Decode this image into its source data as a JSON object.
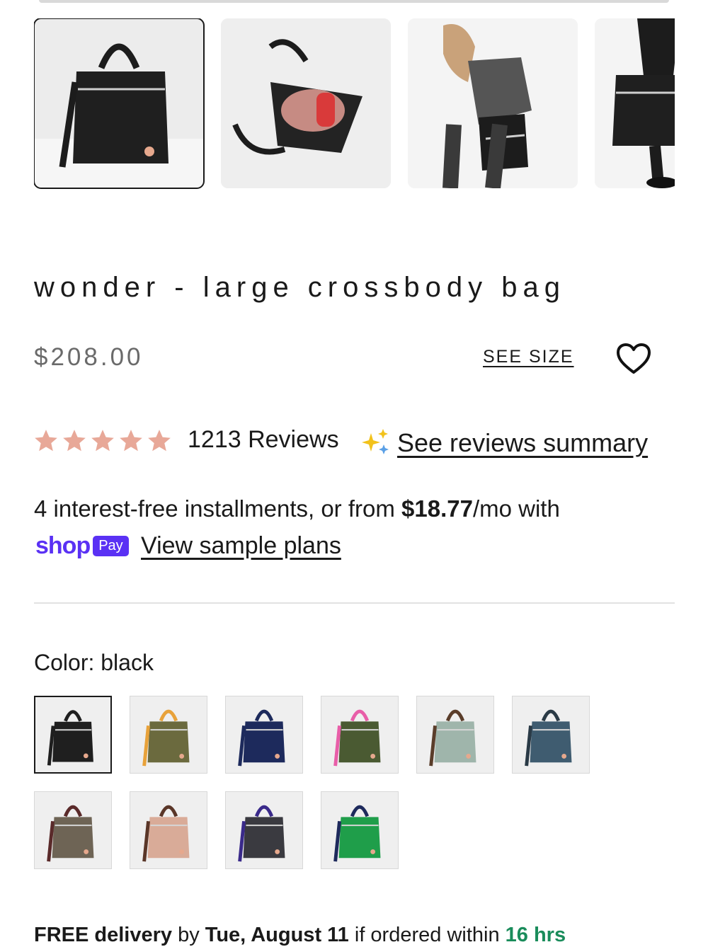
{
  "gallery": {
    "thumbnails": [
      {
        "label": "bag-front",
        "active": true
      },
      {
        "label": "bag-open-interior",
        "active": false
      },
      {
        "label": "model-wearing-bag",
        "active": false
      },
      {
        "label": "model-holding-bag",
        "active": false
      }
    ]
  },
  "product": {
    "title": "wonder - large crossbody bag",
    "price": "$208.00",
    "see_size": "SEE SIZE"
  },
  "reviews": {
    "stars": 5,
    "count_label": "1213 Reviews",
    "summary_link": "See reviews summary",
    "star_color": "#e8a898"
  },
  "payment": {
    "prefix": "4 interest-free installments, or from ",
    "amount": "$18.77",
    "suffix": "/mo with",
    "shop_word": "shop",
    "pay_badge": "Pay",
    "sample_plans": "View sample plans",
    "brand_color": "#5a31f4"
  },
  "color": {
    "label": "Color: black",
    "swatches": [
      {
        "name": "black",
        "color": "#1f1f1f",
        "handle": "#1f1f1f",
        "active": true
      },
      {
        "name": "camo",
        "color": "#6b6a3e",
        "handle": "#e8a23a",
        "active": false
      },
      {
        "name": "navy",
        "color": "#1d2a5c",
        "handle": "#1d2a5c",
        "active": false
      },
      {
        "name": "olive-pink",
        "color": "#4a5a32",
        "handle": "#e85ea8",
        "active": false
      },
      {
        "name": "sage",
        "color": "#9fb5ab",
        "handle": "#5a3d2a",
        "active": false
      },
      {
        "name": "slate-blue",
        "color": "#3f5c70",
        "handle": "#2a3a46",
        "active": false
      },
      {
        "name": "taupe",
        "color": "#6e6455",
        "handle": "#5a2a2a",
        "active": false
      },
      {
        "name": "blush",
        "color": "#d9ab98",
        "handle": "#5a3628",
        "active": false
      },
      {
        "name": "charcoal-purple",
        "color": "#3a3a40",
        "handle": "#3a2a8a",
        "active": false
      },
      {
        "name": "green",
        "color": "#1f9e4a",
        "handle": "#1e2a5c",
        "active": false
      }
    ]
  },
  "delivery": {
    "prefix": "FREE delivery",
    "by": " by ",
    "date": "Tue, August 11",
    "middle": " if ordered within ",
    "time": "16 hrs"
  }
}
